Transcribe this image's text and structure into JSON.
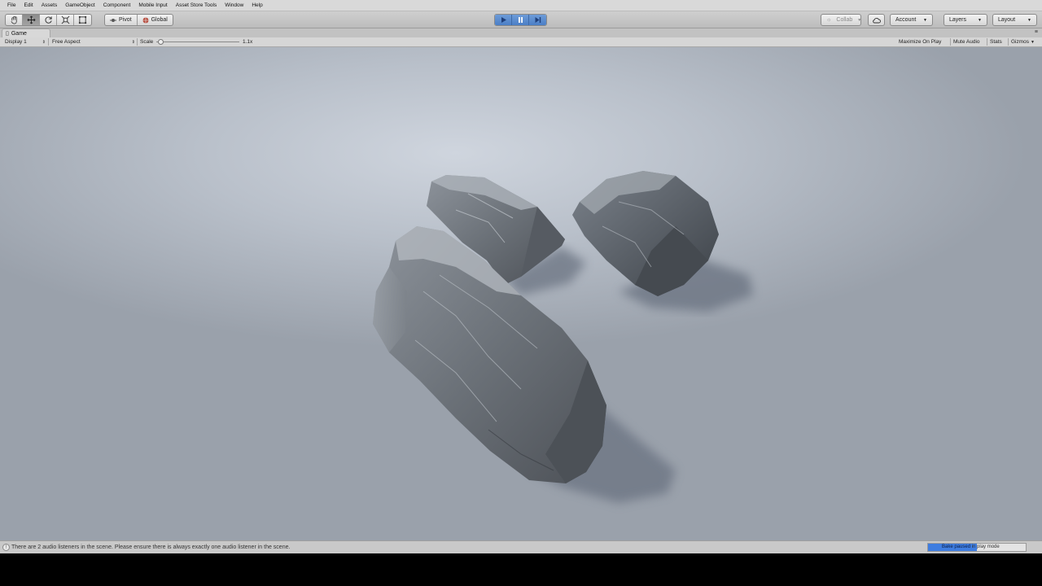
{
  "menu": [
    "File",
    "Edit",
    "Assets",
    "GameObject",
    "Component",
    "Mobile Input",
    "Asset Store Tools",
    "Window",
    "Help"
  ],
  "toolbar": {
    "tools": [
      "hand-tool-icon",
      "move-tool-icon",
      "rotate-tool-icon",
      "scale-tool-icon",
      "rect-tool-icon"
    ],
    "active_tool": "move-tool-icon",
    "pivot_label": "Pivot",
    "global_label": "Global",
    "play_controls": [
      "play-icon",
      "pause-icon",
      "step-icon"
    ],
    "collab_label": "Collab",
    "account_label": "Account",
    "layers_label": "Layers",
    "layout_label": "Layout"
  },
  "tab": {
    "title": "Game"
  },
  "game_view": {
    "display": "Display 1",
    "aspect": "Free Aspect",
    "scale_label": "Scale",
    "scale_value": "1.1x",
    "scale_fraction": 0.05,
    "maximize_label": "Maximize On Play",
    "mute_label": "Mute Audio",
    "stats_label": "Stats",
    "gizmos_label": "Gizmos"
  },
  "status": {
    "message": "There are 2 audio listeners in the scene. Please ensure there is always exactly one audio listener in the scene.",
    "bake_highlight": "Bake paused",
    "bake_rest": " in play mode",
    "bake_progress": 0.5
  },
  "colors": {
    "accent_blue": "#4b7fc6",
    "bake_blue": "#3f7de0",
    "floor": "#b9c0ca"
  }
}
